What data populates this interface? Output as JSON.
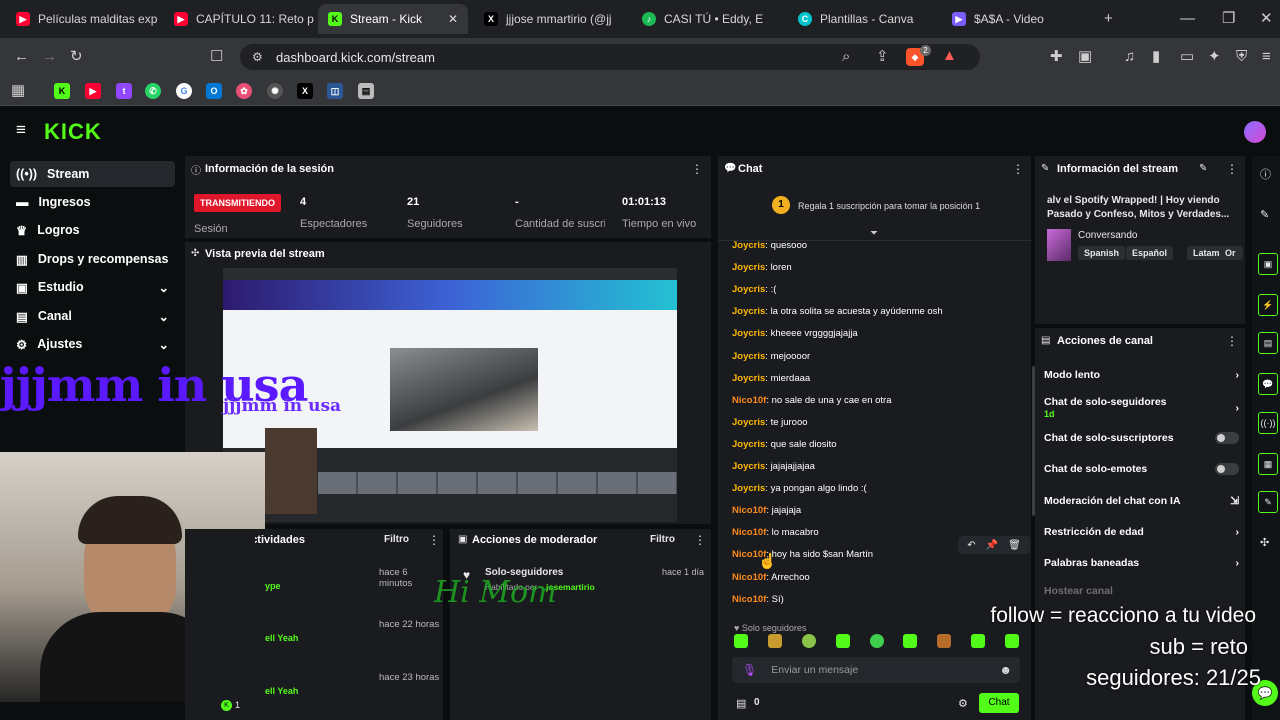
{
  "browser": {
    "tabs": [
      {
        "title": "Películas malditas exp",
        "fav": "▶",
        "color": "#ff0033"
      },
      {
        "title": "CAPÍTULO 11: Reto p",
        "fav": "▶",
        "color": "#ff0033"
      },
      {
        "title": "Stream - Kick",
        "fav": "K",
        "color": "#53fc18"
      },
      {
        "title": "jjjose mmartirio (@jj",
        "fav": "X",
        "color": "#000000"
      },
      {
        "title": "CASI TÚ • Eddy, E",
        "fav": "♪",
        "color": "#1db954"
      },
      {
        "title": "Plantillas - Canva",
        "fav": "C",
        "color": "#00c4cc"
      },
      {
        "title": "$A$A - Video",
        "fav": "▶",
        "color": "#7a5cff"
      }
    ],
    "url": "dashboard.kick.com/stream",
    "notif_count": "2"
  },
  "sidebar": {
    "items": [
      {
        "label": "Stream",
        "icon": "broadcast-icon"
      },
      {
        "label": "Ingresos",
        "icon": "wallet-icon"
      },
      {
        "label": "Logros",
        "icon": "trophy-icon"
      },
      {
        "label": "Drops y recompensas",
        "icon": "gift-icon"
      },
      {
        "label": "Estudio",
        "icon": "studio-icon"
      },
      {
        "label": "Canal",
        "icon": "channel-icon"
      },
      {
        "label": "Ajustes",
        "icon": "gear-icon"
      }
    ]
  },
  "session": {
    "title": "Información de la sesión",
    "status": "TRANSMITIENDO",
    "status_label": "Sesión",
    "viewers": "4",
    "viewers_label": "Espectadores",
    "followers": "21",
    "followers_label": "Seguidores",
    "subs": "-",
    "subs_label": "Cantidad de suscripciones",
    "time": "01:01:13",
    "time_label": "Tiempo en vivo"
  },
  "preview": {
    "title": "Vista previa del stream",
    "caption": "jjjmm in usa"
  },
  "activity": {
    "title": "Actividades",
    "filter": "Filtro",
    "items": [
      {
        "time": "hace 6 minutos",
        "text": "ype"
      },
      {
        "time": "hace 22 horas",
        "text": "ell Yeah"
      },
      {
        "time": "hace 23 horas",
        "text": "ell Yeah"
      }
    ],
    "footer_count": "1"
  },
  "mod": {
    "title": "Acciones de moderador",
    "filter": "Filtro",
    "item_title": "Solo-seguidores",
    "item_time": "hace 1 día",
    "item_sub_prefix": "Habilitado por",
    "item_user": "josemartirio"
  },
  "chat": {
    "title": "Chat",
    "pin_rank": "1",
    "pin_text": "Regala 1 suscripción para tomar la posición 1",
    "messages": [
      {
        "user": "Joycris",
        "text": "quesooo",
        "color": "#ffb800"
      },
      {
        "user": "Joycris",
        "text": "loren",
        "color": "#ffb800"
      },
      {
        "user": "Joycris",
        "text": ":(",
        "color": "#ffb800"
      },
      {
        "user": "Joycris",
        "text": "la otra solita se acuesta y ayúdenme osh",
        "color": "#ffb800"
      },
      {
        "user": "Joycris",
        "text": "kheeee vrggggjajajja",
        "color": "#ffb800"
      },
      {
        "user": "Joycris",
        "text": "mejoooor",
        "color": "#ffb800"
      },
      {
        "user": "Joycris",
        "text": "mierdaaa",
        "color": "#ffb800"
      },
      {
        "user": "Nico10f",
        "text": "no sale de una y cae en otra",
        "color": "#ff8a1c"
      },
      {
        "user": "Joycris",
        "text": "te jurooo",
        "color": "#ffb800"
      },
      {
        "user": "Joycris",
        "text": "que sale diosito",
        "color": "#ffb800"
      },
      {
        "user": "Joycris",
        "text": "jajajajjajaa",
        "color": "#ffb800"
      },
      {
        "user": "Joycris",
        "text": "ya pongan algo lindo :(",
        "color": "#ffb800"
      },
      {
        "user": "Nico10f",
        "text": "jajajaja",
        "color": "#ff8a1c"
      },
      {
        "user": "Nico10f",
        "text": "lo macabro",
        "color": "#ff8a1c"
      },
      {
        "user": "Nico10f",
        "text": "hoy ha sido $san Martín",
        "color": "#ff8a1c"
      },
      {
        "user": "Nico10f",
        "text": "Arrechoo",
        "color": "#ff8a1c"
      },
      {
        "user": "Nico10f",
        "text": "Sí)",
        "color": "#ff8a1c"
      }
    ],
    "mode": "Solo seguidores",
    "placeholder": "Enviar un mensaje",
    "points": "0",
    "send": "Chat"
  },
  "stream_info": {
    "title": "Información del stream",
    "stream_title": "alv el Spotify Wrapped! | Hoy viendo Pasado y Confeso, Mitos y Verdades...",
    "category": "Conversando",
    "tags": [
      "Spanish",
      "Español",
      "Latam",
      "Or"
    ]
  },
  "channel_actions": {
    "title": "Acciones de canal",
    "items": [
      {
        "label": "Modo lento",
        "control": "chevron"
      },
      {
        "label": "Chat de solo-seguidores",
        "sub": "1d",
        "control": "chevron"
      },
      {
        "label": "Chat de solo-suscriptores",
        "control": "toggle"
      },
      {
        "label": "Chat de solo-emotes",
        "control": "toggle"
      },
      {
        "label": "Moderación del chat con IA",
        "control": "link"
      },
      {
        "label": "Restricción de edad",
        "control": "chevron"
      },
      {
        "label": "Palabras baneadas",
        "control": "chevron"
      },
      {
        "label": "Hostear canal",
        "control": "none"
      }
    ]
  },
  "overlay": {
    "line1": "follow = reacciono a tu video",
    "line2": "sub = reto",
    "line3": "seguidores: 21/25",
    "watermark": "Hi Mom"
  },
  "colors": {
    "kick_green": "#53fc18",
    "live_red": "#e0162b",
    "panel": "#191b1f"
  }
}
